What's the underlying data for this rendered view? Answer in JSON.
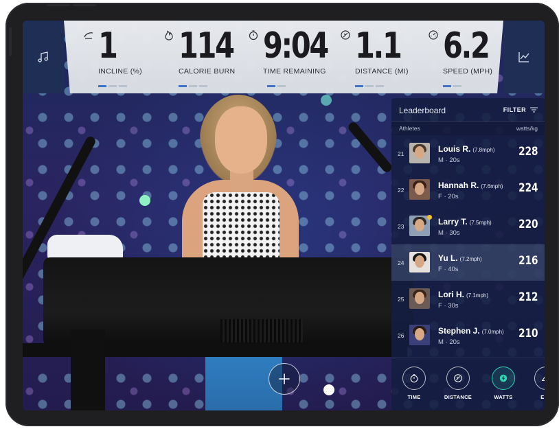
{
  "metrics": [
    {
      "icon": "incline-icon",
      "value": "1",
      "label": "INCLINE (%)"
    },
    {
      "icon": "flame-icon",
      "value": "114",
      "label": "CALORIE BURN"
    },
    {
      "icon": "timer-icon",
      "value": "9:04",
      "label": "TIME REMAINING"
    },
    {
      "icon": "distance-icon",
      "value": "1.1",
      "label": "DISTANCE (MI)"
    },
    {
      "icon": "speedometer-icon",
      "value": "6.2",
      "label": "SPEED (MPH)"
    }
  ],
  "left_tab_icon": "music-note-icon",
  "right_tab_icon": "chart-icon",
  "leaderboard": {
    "title": "Leaderboard",
    "filter_label": "FILTER",
    "col_athletes": "Athletes",
    "col_metric": "watts/kg",
    "rows": [
      {
        "rank": "21",
        "name": "Louis R.",
        "speed": "(7.8mph)",
        "meta": "M · 20s",
        "score": "228"
      },
      {
        "rank": "22",
        "name": "Hannah R.",
        "speed": "(7.6mph)",
        "meta": "F · 20s",
        "score": "224"
      },
      {
        "rank": "23",
        "name": "Larry T.",
        "speed": "(7.5mph)",
        "meta": "M · 30s",
        "score": "220"
      },
      {
        "rank": "24",
        "name": "Yu L.",
        "speed": "(7.2mph)",
        "meta": "F · 40s",
        "score": "216"
      },
      {
        "rank": "25",
        "name": "Lori H.",
        "speed": "(7.1mph)",
        "meta": "F · 30s",
        "score": "212"
      },
      {
        "rank": "26",
        "name": "Stephen J.",
        "speed": "(7.0mph)",
        "meta": "M · 20s",
        "score": "210"
      }
    ],
    "modes": [
      {
        "icon": "timer-icon",
        "label": "TIME"
      },
      {
        "icon": "distance-icon",
        "label": "DISTANCE"
      },
      {
        "icon": "bolt-icon",
        "label": "WATTS"
      },
      {
        "icon": "elevation-icon",
        "label": "ELE"
      }
    ]
  },
  "colors": {
    "accent": "#3f74c9",
    "active_mode": "#2fd3b0",
    "online_dot": "#f2c230",
    "panel": "#1f2e55"
  }
}
